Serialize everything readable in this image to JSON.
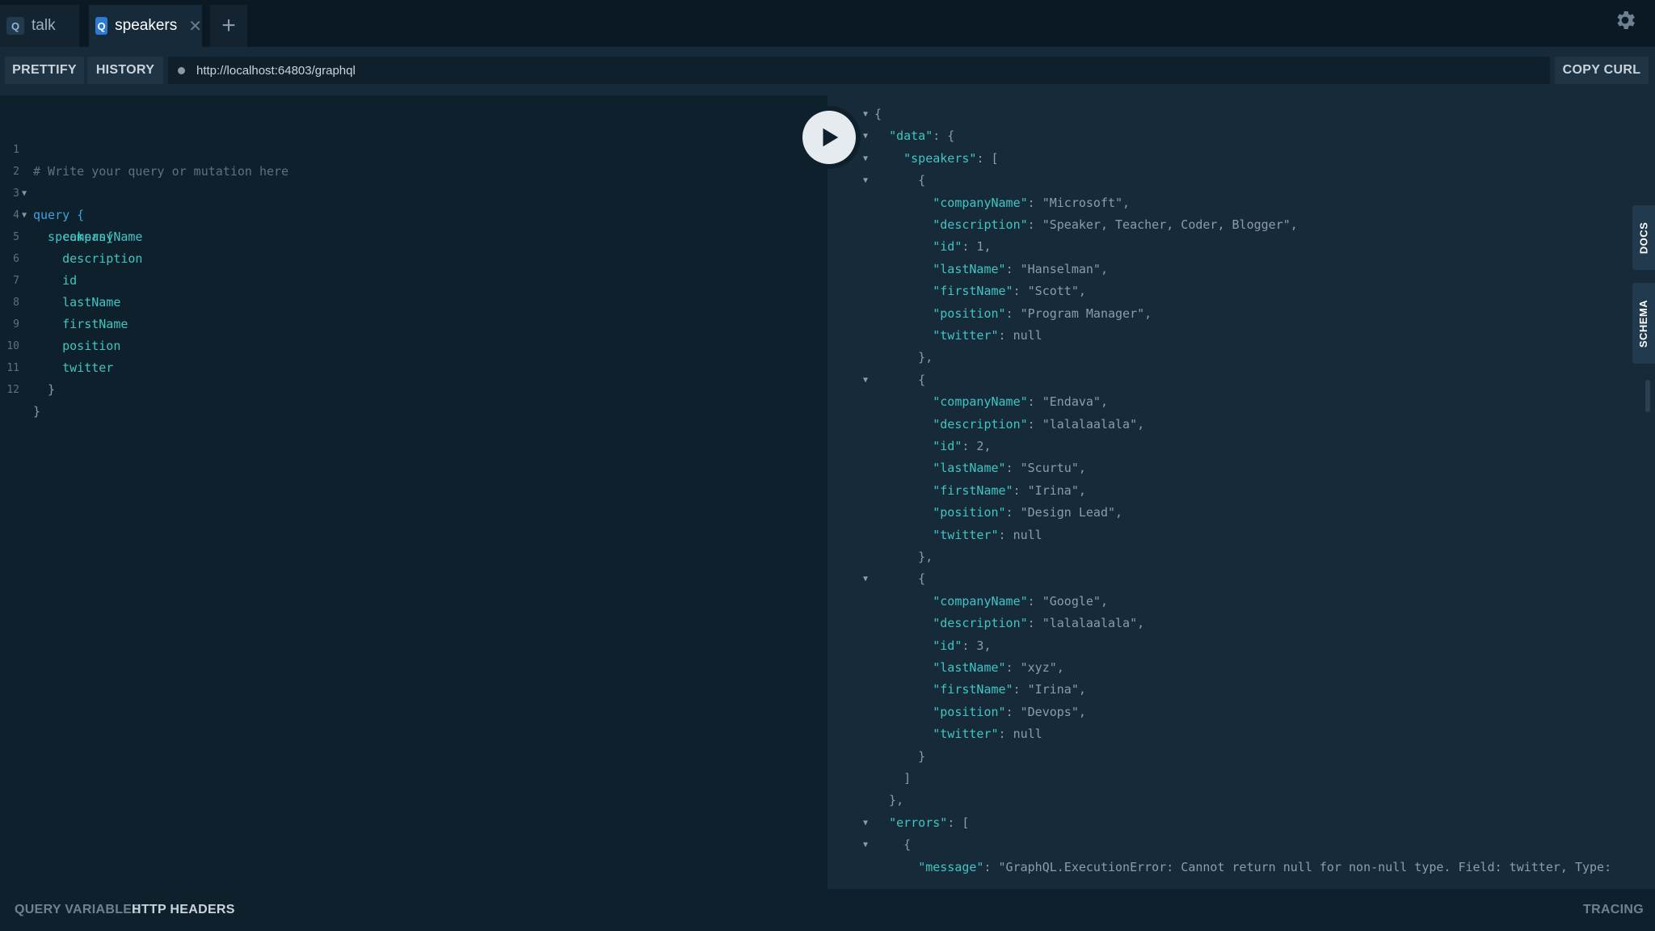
{
  "tabs": [
    {
      "badge": "Q",
      "label": "talk",
      "active": false
    },
    {
      "badge": "Q",
      "label": "speakers",
      "active": true,
      "close": "✕"
    }
  ],
  "add_tab_label": "+",
  "toolbar": {
    "prettify_label": "PRETTIFY",
    "history_label": "HISTORY",
    "url_value": "http://localhost:64803/graphql",
    "copy_curl_label": "COPY CURL"
  },
  "editor": {
    "line_numbers": [
      "1",
      "2",
      "3",
      "4",
      "5",
      "6",
      "7",
      "8",
      "9",
      "10",
      "11",
      "12"
    ],
    "lines": [
      "# Write your query or mutation here",
      "query {",
      "  speakers{",
      "    companyName",
      "    description",
      "    id",
      "    lastName",
      "    firstName",
      "    position",
      "    twitter",
      "  }",
      "}"
    ]
  },
  "result": {
    "lines": [
      "{",
      "  \"data\": {",
      "    \"speakers\": [",
      "      {",
      "        \"companyName\": \"Microsoft\",",
      "        \"description\": \"Speaker, Teacher, Coder, Blogger\",",
      "        \"id\": 1,",
      "        \"lastName\": \"Hanselman\",",
      "        \"firstName\": \"Scott\",",
      "        \"position\": \"Program Manager\",",
      "        \"twitter\": null",
      "      },",
      "      {",
      "        \"companyName\": \"Endava\",",
      "        \"description\": \"lalalaalala\",",
      "        \"id\": 2,",
      "        \"lastName\": \"Scurtu\",",
      "        \"firstName\": \"Irina\",",
      "        \"position\": \"Design Lead\",",
      "        \"twitter\": null",
      "      },",
      "      {",
      "        \"companyName\": \"Google\",",
      "        \"description\": \"lalalaalala\",",
      "        \"id\": 3,",
      "        \"lastName\": \"xyz\",",
      "        \"firstName\": \"Irina\",",
      "        \"position\": \"Devops\",",
      "        \"twitter\": null",
      "      }",
      "    ]",
      "  },",
      "  \"errors\": [",
      "    {",
      "      \"message\": \"GraphQL.ExecutionError: Cannot return null for non-null type. Field: twitter, Type:"
    ]
  },
  "side_tabs": {
    "docs_label": "DOCS",
    "schema_label": "SCHEMA"
  },
  "bottom": {
    "query_variables_label": "QUERY VARIABLES",
    "http_headers_label": "HTTP HEADERS",
    "tracing_label": "TRACING"
  },
  "icons": {
    "settings": "gear-icon",
    "run": "play-icon",
    "url_status": "status-dot-icon"
  },
  "colors": {
    "background": "#172a3a",
    "editor_background": "#0f202d",
    "active_tab_badge": "#2b7ad6",
    "json_key": "#3fc5c2",
    "keyword": "#3ea2e0"
  }
}
